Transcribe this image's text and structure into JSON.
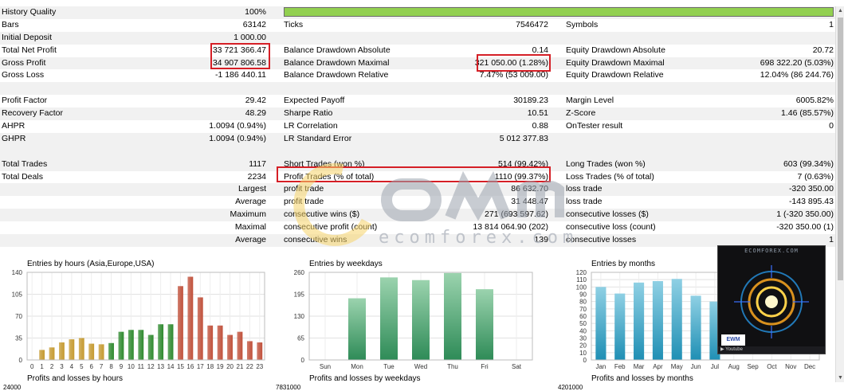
{
  "rows": [
    {
      "l1": "History Quality",
      "v1": "100%",
      "bar": true
    },
    {
      "l1": "Bars",
      "v1": "63142",
      "l2": "Ticks",
      "v2": "7546472",
      "l3": "Symbols",
      "v3": "1"
    },
    {
      "l1": "Initial Deposit",
      "v1": "1 000.00"
    },
    {
      "l1": "Total Net Profit",
      "v1": "33 721 366.47",
      "l2": "Balance Drawdown Absolute",
      "v2": "0.14",
      "l3": "Equity Drawdown Absolute",
      "v3": "20.72"
    },
    {
      "l1": "Gross Profit",
      "v1": "34 907 806.58",
      "l2": "Balance Drawdown Maximal",
      "v2": "321 050.00 (1.28%)",
      "l3": "Equity Drawdown Maximal",
      "v3": "698 322.20 (5.03%)"
    },
    {
      "l1": "Gross Loss",
      "v1": "-1 186 440.11",
      "l2": "Balance Drawdown Relative",
      "v2": "7.47% (53 009.00)",
      "l3": "Equity Drawdown Relative",
      "v3": "12.04% (86 244.76)"
    },
    {},
    {
      "l1": "Profit Factor",
      "v1": "29.42",
      "l2": "Expected Payoff",
      "v2": "30189.23",
      "l3": "Margin Level",
      "v3": "6005.82%"
    },
    {
      "l1": "Recovery Factor",
      "v1": "48.29",
      "l2": "Sharpe Ratio",
      "v2": "10.51",
      "l3": "Z-Score",
      "v3": "1.46 (85.57%)"
    },
    {
      "l1": "AHPR",
      "v1": "1.0094 (0.94%)",
      "l2": "LR Correlation",
      "v2": "0.88",
      "l3": "OnTester result",
      "v3": "0"
    },
    {
      "l1": "GHPR",
      "v1": "1.0094 (0.94%)",
      "l2": "LR Standard Error",
      "v2": "5 012 377.83"
    },
    {},
    {
      "l1": "Total Trades",
      "v1": "1117",
      "l2": "Short Trades (won %)",
      "v2": "514 (99.42%)",
      "l3": "Long Trades (won %)",
      "v3": "603 (99.34%)"
    },
    {
      "l1": "Total Deals",
      "v1": "2234",
      "l2": "Profit Trades (% of total)",
      "v2": "1110 (99.37%)",
      "l3": "Loss Trades (% of total)",
      "v3": "7 (0.63%)"
    },
    {
      "r1": "Largest",
      "l2": "profit trade",
      "v2": "86 632.70",
      "l3": "loss trade",
      "v3": "-320 350.00"
    },
    {
      "r1": "Average",
      "l2": "profit trade",
      "v2": "31 448.47",
      "l3": "loss trade",
      "v3": "-143 895.43"
    },
    {
      "r1": "Maximum",
      "l2": "consecutive wins ($)",
      "v2": "271 (693 597.62)",
      "l3": "consecutive losses ($)",
      "v3": "1 (-320 350.00)"
    },
    {
      "r1": "Maximal",
      "l2": "consecutive profit (count)",
      "v2": "13 814 064.90 (202)",
      "l3": "consecutive loss (count)",
      "v3": "-320 350.00 (1)"
    },
    {
      "r1": "Average",
      "l2": "consecutive wins",
      "v2": "139",
      "l3": "consecutive losses",
      "v3": "1"
    }
  ],
  "watermark": {
    "text": "ecomforex.com"
  },
  "thumbnail": {
    "header": "ECOMFOREX.COM",
    "brand": "EWM",
    "controls": "▶ Youtube"
  },
  "subtitles": {
    "hours": "Profits and losses by hours",
    "weekdays": "Profits and losses by weekdays",
    "months": "Profits and losses by months",
    "hours_axis": "24000",
    "weekdays_axis": "7831000",
    "months_axis": "4201000"
  },
  "chart_data": [
    {
      "type": "bar",
      "title": "Entries by hours (Asia,Europe,USA)",
      "categories": [
        "0",
        "1",
        "2",
        "3",
        "4",
        "5",
        "6",
        "7",
        "8",
        "9",
        "10",
        "11",
        "12",
        "13",
        "14",
        "15",
        "16",
        "17",
        "18",
        "19",
        "20",
        "21",
        "22",
        "23"
      ],
      "values": [
        0,
        16,
        20,
        28,
        33,
        35,
        26,
        25,
        27,
        45,
        48,
        48,
        40,
        57,
        57,
        118,
        133,
        100,
        55,
        55,
        40,
        45,
        30,
        28
      ],
      "colors": [
        "#c0a060",
        "#c59a30",
        "#c59a30",
        "#c59a30",
        "#c59a30",
        "#c59a30",
        "#c59a30",
        "#c59a30",
        "#2f8a2f",
        "#2f8a2f",
        "#2f8a2f",
        "#2f8a2f",
        "#2f8a2f",
        "#2f8a2f",
        "#2f8a2f",
        "#c0503a",
        "#c0503a",
        "#c0503a",
        "#c0503a",
        "#c0503a",
        "#c0503a",
        "#c0503a",
        "#c0503a",
        "#c0503a"
      ],
      "ylim": [
        0,
        140
      ],
      "yticks": [
        "140",
        "105",
        "70",
        "35",
        "0"
      ]
    },
    {
      "type": "bar",
      "title": "Entries by weekdays",
      "categories": [
        "Sun",
        "Mon",
        "Tue",
        "Wed",
        "Thu",
        "Fri",
        "Sat"
      ],
      "values": [
        0,
        183,
        245,
        237,
        258,
        210,
        0
      ],
      "ylim": [
        0,
        260
      ],
      "yticks": [
        "260",
        "195",
        "130",
        "65",
        "0"
      ]
    },
    {
      "type": "bar",
      "title": "Entries by months",
      "categories": [
        "Jan",
        "Feb",
        "Mar",
        "Apr",
        "May",
        "Jun",
        "Jul",
        "Aug",
        "Sep",
        "Oct",
        "Nov",
        "Dec"
      ],
      "values": [
        100,
        91,
        106,
        108,
        111,
        88,
        80,
        0,
        0,
        0,
        0,
        0
      ],
      "ylim": [
        0,
        120
      ],
      "yticks": [
        "120",
        "110",
        "100",
        "90",
        "80",
        "70",
        "60",
        "50",
        "40",
        "30",
        "20",
        "10",
        "0"
      ]
    }
  ]
}
